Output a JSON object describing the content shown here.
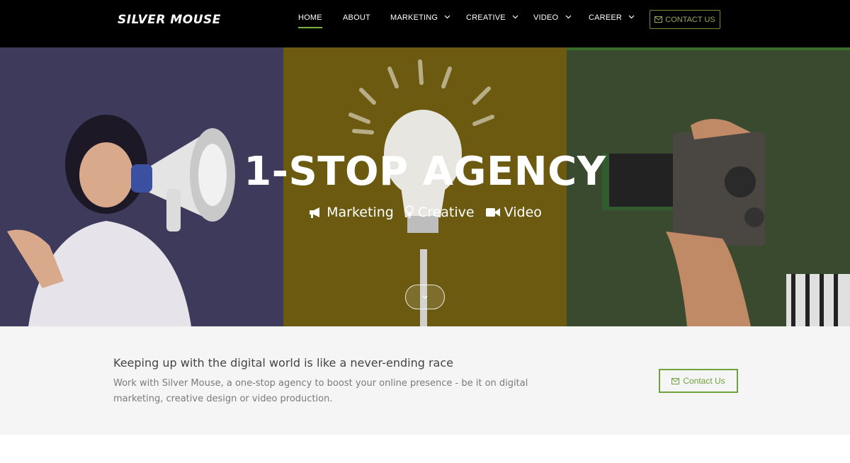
{
  "brand": {
    "logo": "SILVER MOUSE"
  },
  "nav": {
    "items": [
      {
        "label": "HOME",
        "active": true,
        "dropdown": false
      },
      {
        "label": "ABOUT",
        "active": false,
        "dropdown": false
      },
      {
        "label": "MARKETING",
        "active": false,
        "dropdown": true
      },
      {
        "label": "CREATIVE",
        "active": false,
        "dropdown": true
      },
      {
        "label": "VIDEO",
        "active": false,
        "dropdown": true
      },
      {
        "label": "CAREER",
        "active": false,
        "dropdown": true
      }
    ],
    "contact_label": "CONTACT US"
  },
  "hero": {
    "title": "1-STOP AGENCY",
    "services": [
      {
        "icon": "megaphone-icon",
        "label": "Marketing"
      },
      {
        "icon": "lightbulb-icon",
        "label": "Creative"
      },
      {
        "icon": "video-camera-icon",
        "label": "Video"
      }
    ]
  },
  "cta": {
    "heading": "Keeping up with the digital world is like a never-ending race",
    "text": "Work with Silver Mouse, a one-stop agency to boost your online presence - be it on digital marketing, creative design or video production.",
    "button_label": "Contact Us"
  },
  "colors": {
    "nav_bg": "#000000",
    "accent": "#6fa13a",
    "panel_marketing": "#3d3a5c",
    "panel_creative": "#6b5a10",
    "panel_video": "#3a4a2e",
    "cta_bg": "#f5f5f5"
  }
}
